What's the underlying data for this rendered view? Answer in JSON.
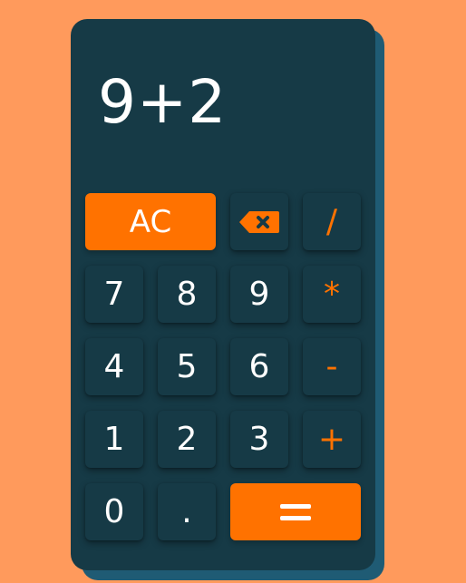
{
  "display": {
    "expression": "9+2"
  },
  "keys": {
    "clear": "AC",
    "backspace_icon": "backspace-icon",
    "divide": "/",
    "seven": "7",
    "eight": "8",
    "nine": "9",
    "multiply": "*",
    "four": "4",
    "five": "5",
    "six": "6",
    "subtract": "-",
    "one": "1",
    "two": "2",
    "three": "3",
    "add": "+",
    "zero": "0",
    "decimal": ".",
    "equals_icon": "equals-icon"
  },
  "colors": {
    "page_background": "#ff9a5c",
    "calculator_body": "#163a46",
    "calculator_shadow": "#1f5b74",
    "accent": "#ff7200",
    "text": "#ffffff"
  }
}
